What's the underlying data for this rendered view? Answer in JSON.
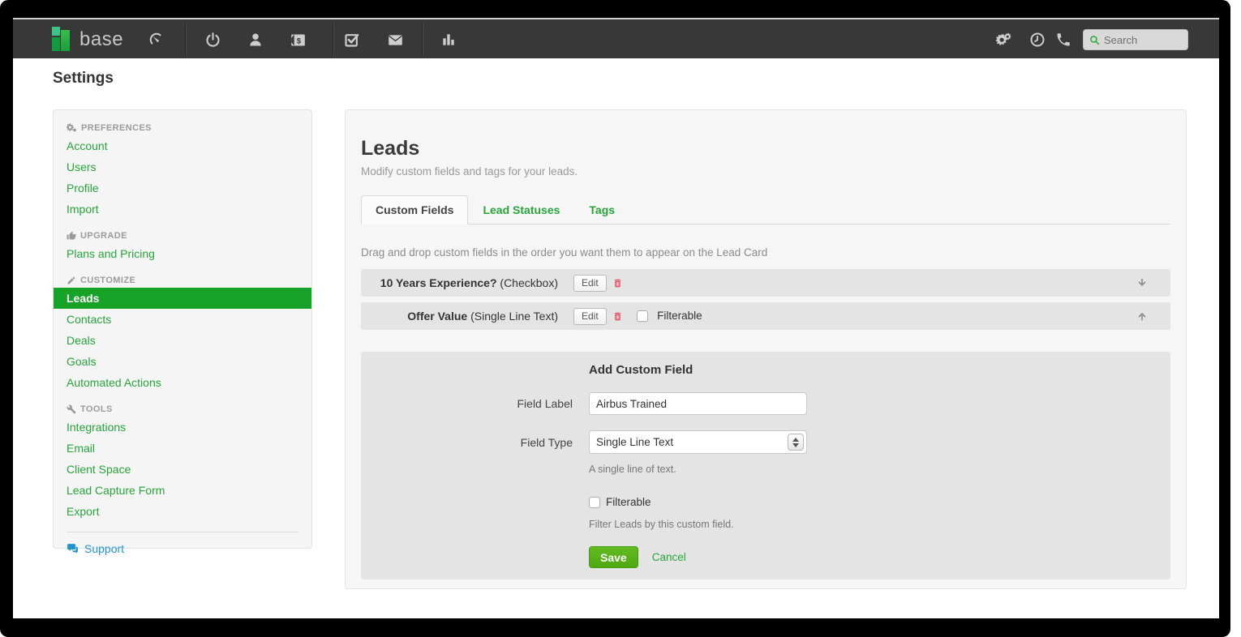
{
  "page_title": "Settings",
  "navbar": {
    "brand": "base",
    "left_icons": [
      "dashboard-gauge",
      "leads-power",
      "contacts-person",
      "sales-dollar",
      "tasks-check",
      "email-envelope",
      "reports-bars"
    ],
    "right_icons": [
      "settings-gears",
      "history-clock",
      "phone"
    ],
    "search_placeholder": "Search"
  },
  "sidebar": {
    "sections": [
      {
        "label": "PREFERENCES",
        "icon": "gears",
        "items": [
          {
            "label": "Account"
          },
          {
            "label": "Users"
          },
          {
            "label": "Profile"
          },
          {
            "label": "Import"
          }
        ]
      },
      {
        "label": "UPGRADE",
        "icon": "thumbs-up",
        "items": [
          {
            "label": "Plans and Pricing"
          }
        ]
      },
      {
        "label": "CUSTOMIZE",
        "icon": "pencil",
        "items": [
          {
            "label": "Leads",
            "active": true
          },
          {
            "label": "Contacts"
          },
          {
            "label": "Deals"
          },
          {
            "label": "Goals"
          },
          {
            "label": "Automated Actions"
          }
        ]
      },
      {
        "label": "TOOLS",
        "icon": "wrench",
        "items": [
          {
            "label": "Integrations"
          },
          {
            "label": "Email"
          },
          {
            "label": "Client Space"
          },
          {
            "label": "Lead Capture Form"
          },
          {
            "label": "Export"
          }
        ]
      }
    ],
    "support_label": "Support",
    "support_icon": "chat-bubbles"
  },
  "main": {
    "title": "Leads",
    "subtitle": "Modify custom fields and tags for your leads.",
    "tabs": [
      {
        "label": "Custom Fields",
        "active": true
      },
      {
        "label": "Lead Statuses",
        "active": false
      },
      {
        "label": "Tags",
        "active": false
      }
    ],
    "hint": "Drag and drop custom fields in the order you want them to appear on the Lead Card",
    "fields": [
      {
        "name": "10 Years Experience?",
        "type": "(Checkbox)",
        "edit_label": "Edit",
        "move_icon": "arrow-down"
      },
      {
        "name": "Offer Value",
        "type": "(Single Line Text)",
        "edit_label": "Edit",
        "filterable_label": "Filterable",
        "filterable_checked": false,
        "move_icon": "arrow-up"
      }
    ],
    "form": {
      "title": "Add Custom Field",
      "field_label_label": "Field Label",
      "field_label_value": "Airbus Trained",
      "field_type_label": "Field Type",
      "field_type_value": "Single Line Text",
      "field_type_help": "A single line of text.",
      "filterable_label": "Filterable",
      "filterable_checked": false,
      "filterable_help": "Filter Leads by this custom field.",
      "save_label": "Save",
      "cancel_label": "Cancel"
    }
  },
  "colors": {
    "navbar_bg": "#383838",
    "accent_green": "#27a53a",
    "active_item_green": "#17a327",
    "save_button_green": "#56b318",
    "support_blue": "#2196cf",
    "delete_red": "#e0556a",
    "panel_bg": "#f5f5f6",
    "row_bg": "#e4e4e5"
  }
}
